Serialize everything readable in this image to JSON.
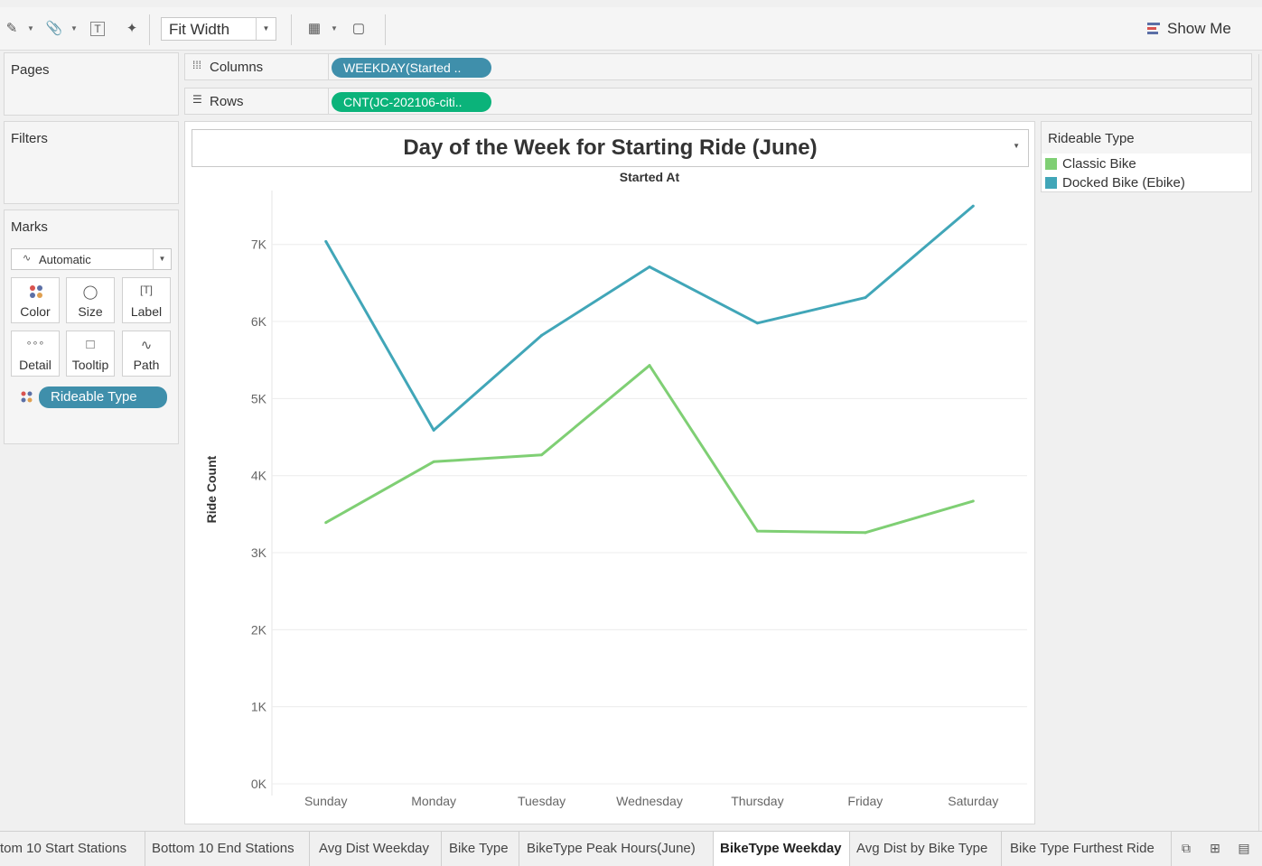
{
  "toolbar": {
    "fit_label": "Fit Width",
    "show_me_label": "Show Me"
  },
  "panels": {
    "pages_title": "Pages",
    "filters_title": "Filters",
    "marks_title": "Marks",
    "mark_type": "Automatic",
    "mark_buttons": [
      "Color",
      "Size",
      "Label",
      "Detail",
      "Tooltip",
      "Path"
    ],
    "color_pill": "Rideable Type"
  },
  "shelves": {
    "columns_label": "Columns",
    "columns_pill": "WEEKDAY(Started ..",
    "rows_label": "Rows",
    "rows_pill": "CNT(JC-202106-citi.."
  },
  "legend": {
    "title": "Rideable Type",
    "items": [
      {
        "label": "Classic Bike",
        "color": "#7fcf74"
      },
      {
        "label": "Docked Bike (Ebike)",
        "color": "#41a6b8"
      }
    ]
  },
  "tabs": [
    "tom 10 Start Stations",
    "Bottom 10 End Stations",
    "Avg Dist Weekday",
    "Bike Type",
    "BikeType Peak Hours(June)",
    "BikeType Weekday",
    "Avg Dist by Bike Type",
    "Bike Type Furthest Ride"
  ],
  "active_tab": "BikeType Weekday",
  "chart_data": {
    "type": "line",
    "title": "Day of the Week for Starting Ride (June)",
    "subtitle": "Started At",
    "ylabel": "Ride Count",
    "xlabel": "",
    "categories": [
      "Sunday",
      "Monday",
      "Tuesday",
      "Wednesday",
      "Thursday",
      "Friday",
      "Saturday"
    ],
    "yticks": [
      "0K",
      "1K",
      "2K",
      "3K",
      "4K",
      "5K",
      "6K",
      "7K"
    ],
    "ylim": [
      0,
      7700
    ],
    "grid": true,
    "series": [
      {
        "name": "Classic Bike",
        "color": "#7fcf74",
        "values": [
          3390,
          4180,
          4270,
          5430,
          3280,
          3260,
          3670
        ]
      },
      {
        "name": "Docked Bike (Ebike)",
        "color": "#41a6b8",
        "values": [
          7040,
          4590,
          5820,
          6710,
          5980,
          6310,
          7500
        ]
      }
    ]
  }
}
